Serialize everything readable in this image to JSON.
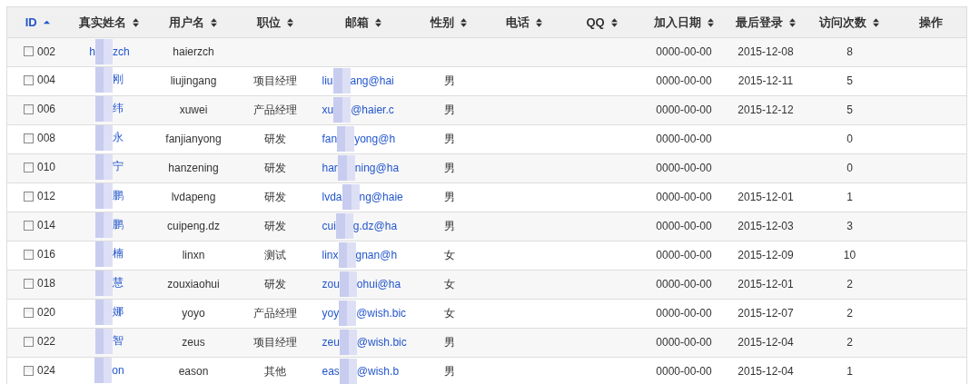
{
  "table": {
    "columns": [
      {
        "label": "ID",
        "sortable": true,
        "sorted_ascending": true
      },
      {
        "label": "真实姓名",
        "sortable": true,
        "sorted_ascending": false
      },
      {
        "label": "用户名",
        "sortable": true,
        "sorted_ascending": false
      },
      {
        "label": "职位",
        "sortable": true,
        "sorted_ascending": false
      },
      {
        "label": "邮箱",
        "sortable": true,
        "sorted_ascending": false
      },
      {
        "label": "性别",
        "sortable": true,
        "sorted_ascending": false
      },
      {
        "label": "电话",
        "sortable": true,
        "sorted_ascending": false
      },
      {
        "label": "QQ",
        "sortable": true,
        "sorted_ascending": false
      },
      {
        "label": "加入日期",
        "sortable": true,
        "sorted_ascending": false
      },
      {
        "label": "最后登录",
        "sortable": true,
        "sorted_ascending": false
      },
      {
        "label": "访问次数",
        "sortable": true,
        "sorted_ascending": false
      },
      {
        "label": "操作",
        "sortable": false
      }
    ],
    "rows": [
      {
        "checked": false,
        "id": "002",
        "name": {
          "before": "h",
          "after": "zch"
        },
        "username": "haierzch",
        "joined": "0000-00-00",
        "last_login": "2015-12-08",
        "visits": "8"
      },
      {
        "checked": false,
        "id": "004",
        "name": {
          "after": "刚"
        },
        "username": "liujingang",
        "position": "项目经理",
        "email": {
          "before": "liu",
          "after": "ang@hai"
        },
        "gender": "男",
        "joined": "0000-00-00",
        "last_login": "2015-12-11",
        "visits": "5"
      },
      {
        "checked": false,
        "id": "006",
        "name": {
          "after": "纬"
        },
        "username": "xuwei",
        "position": "产品经理",
        "email": {
          "before": "xu",
          "after": "@haier.c"
        },
        "gender": "男",
        "joined": "0000-00-00",
        "last_login": "2015-12-12",
        "visits": "5"
      },
      {
        "checked": false,
        "id": "008",
        "name": {
          "after": "永"
        },
        "username": "fanjianyong",
        "position": "研发",
        "email": {
          "before": "fan",
          "after": "yong@h"
        },
        "gender": "男",
        "joined": "0000-00-00",
        "visits": "0"
      },
      {
        "checked": false,
        "id": "010",
        "name": {
          "after": "宁"
        },
        "username": "hanzening",
        "position": "研发",
        "email": {
          "before": "har",
          "after": "ning@ha"
        },
        "gender": "男",
        "joined": "0000-00-00",
        "visits": "0"
      },
      {
        "checked": false,
        "id": "012",
        "name": {
          "after": "鹏"
        },
        "username": "lvdapeng",
        "position": "研发",
        "email": {
          "before": "lvda",
          "after": "ng@haie"
        },
        "gender": "男",
        "joined": "0000-00-00",
        "last_login": "2015-12-01",
        "visits": "1"
      },
      {
        "checked": false,
        "id": "014",
        "name": {
          "after": "鹏"
        },
        "username": "cuipeng.dz",
        "position": "研发",
        "email": {
          "before": "cui",
          "after": "g.dz@ha"
        },
        "gender": "男",
        "joined": "0000-00-00",
        "last_login": "2015-12-03",
        "visits": "3"
      },
      {
        "checked": false,
        "id": "016",
        "name": {
          "after": "楠"
        },
        "username": "linxn",
        "position": "测试",
        "email": {
          "before": "linx",
          "after": "gnan@h"
        },
        "gender": "女",
        "joined": "0000-00-00",
        "last_login": "2015-12-09",
        "visits": "10"
      },
      {
        "checked": false,
        "id": "018",
        "name": {
          "after": "慧"
        },
        "username": "zouxiaohui",
        "position": "研发",
        "email": {
          "before": "zou",
          "after": "ohui@ha"
        },
        "gender": "女",
        "joined": "0000-00-00",
        "last_login": "2015-12-01",
        "visits": "2"
      },
      {
        "checked": false,
        "id": "020",
        "name": {
          "after": "娜"
        },
        "username": "yoyo",
        "position": "产品经理",
        "email": {
          "before": "yoy",
          "after": "@wish.bic"
        },
        "gender": "女",
        "joined": "0000-00-00",
        "last_login": "2015-12-07",
        "visits": "2"
      },
      {
        "checked": false,
        "id": "022",
        "name": {
          "after": "智"
        },
        "username": "zeus",
        "position": "项目经理",
        "email": {
          "before": "zeu",
          "after": "@wish.bic"
        },
        "gender": "男",
        "joined": "0000-00-00",
        "last_login": "2015-12-04",
        "visits": "2"
      },
      {
        "checked": false,
        "id": "024",
        "name": {
          "after": "on"
        },
        "username": "eason",
        "position": "其他",
        "email": {
          "before": "eas",
          "after": "@wish.b"
        },
        "gender": "男",
        "joined": "0000-00-00",
        "last_login": "2015-12-04",
        "visits": "1"
      }
    ]
  }
}
